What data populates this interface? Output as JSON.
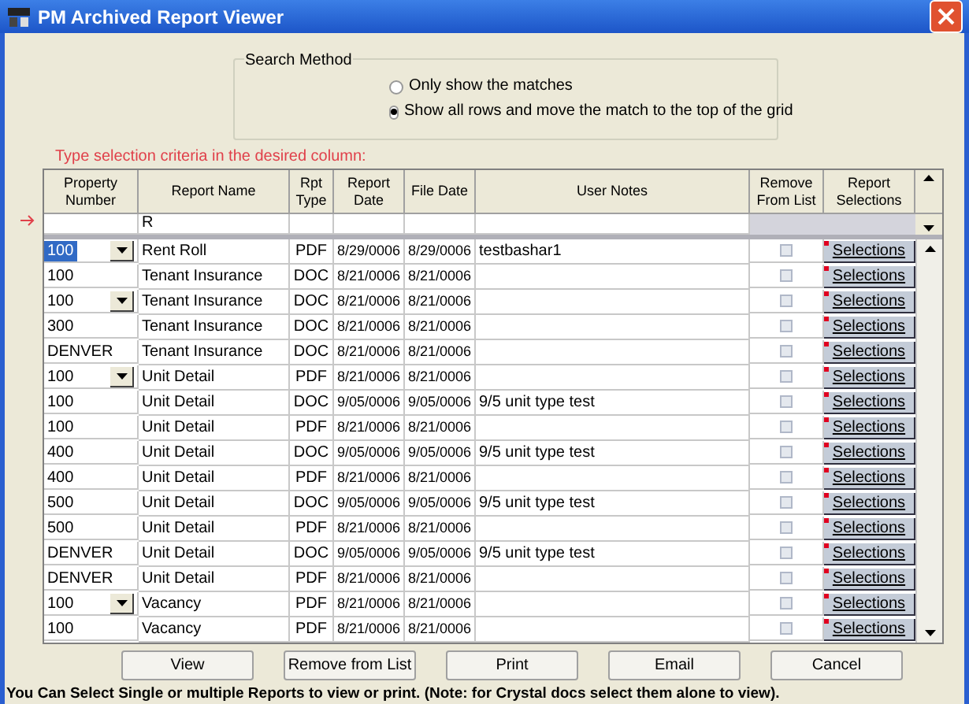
{
  "window": {
    "title": "PM Archived Report Viewer"
  },
  "search_method": {
    "legend": "Search Method",
    "options": [
      {
        "label": "Only show the matches",
        "selected": false
      },
      {
        "label": "Show all rows and move the match to the top of the grid",
        "selected": true
      }
    ]
  },
  "criteria_hint": "Type selection criteria in the desired column:",
  "table": {
    "columns": [
      "Property Number",
      "Report Name",
      "Rpt Type",
      "Report Date",
      "File Date",
      "User Notes",
      "Remove From List",
      "Report Selections"
    ],
    "filter": {
      "report_name": "R"
    },
    "rows": [
      {
        "property": "100",
        "name": "Rent Roll",
        "type": "PDF",
        "report_date": "8/29/0006",
        "file_date": "8/29/0006",
        "notes": "testbashar1",
        "dropdown": true,
        "selected": true,
        "checked": false,
        "action": "Selections"
      },
      {
        "property": "100",
        "name": "Tenant Insurance",
        "type": "DOC",
        "report_date": "8/21/0006",
        "file_date": "8/21/0006",
        "notes": "",
        "dropdown": false,
        "selected": false,
        "checked": false,
        "action": "Selections"
      },
      {
        "property": "100",
        "name": "Tenant Insurance",
        "type": "DOC",
        "report_date": "8/21/0006",
        "file_date": "8/21/0006",
        "notes": "",
        "dropdown": true,
        "selected": false,
        "checked": false,
        "action": "Selections"
      },
      {
        "property": "300",
        "name": "Tenant Insurance",
        "type": "DOC",
        "report_date": "8/21/0006",
        "file_date": "8/21/0006",
        "notes": "",
        "dropdown": false,
        "selected": false,
        "checked": false,
        "action": "Selections"
      },
      {
        "property": "DENVER",
        "name": "Tenant Insurance",
        "type": "DOC",
        "report_date": "8/21/0006",
        "file_date": "8/21/0006",
        "notes": "",
        "dropdown": false,
        "selected": false,
        "checked": false,
        "action": "Selections"
      },
      {
        "property": "100",
        "name": "Unit Detail",
        "type": "PDF",
        "report_date": "8/21/0006",
        "file_date": "8/21/0006",
        "notes": "",
        "dropdown": true,
        "selected": false,
        "checked": false,
        "action": "Selections"
      },
      {
        "property": "100",
        "name": "Unit Detail",
        "type": "DOC",
        "report_date": "9/05/0006",
        "file_date": "9/05/0006",
        "notes": "9/5 unit type test",
        "dropdown": false,
        "selected": false,
        "checked": false,
        "action": "Selections"
      },
      {
        "property": "100",
        "name": "Unit Detail",
        "type": "PDF",
        "report_date": "8/21/0006",
        "file_date": "8/21/0006",
        "notes": "",
        "dropdown": false,
        "selected": false,
        "checked": false,
        "action": "Selections"
      },
      {
        "property": "400",
        "name": "Unit Detail",
        "type": "DOC",
        "report_date": "9/05/0006",
        "file_date": "9/05/0006",
        "notes": "9/5 unit type test",
        "dropdown": false,
        "selected": false,
        "checked": false,
        "action": "Selections"
      },
      {
        "property": "400",
        "name": "Unit Detail",
        "type": "PDF",
        "report_date": "8/21/0006",
        "file_date": "8/21/0006",
        "notes": "",
        "dropdown": false,
        "selected": false,
        "checked": false,
        "action": "Selections"
      },
      {
        "property": "500",
        "name": "Unit Detail",
        "type": "DOC",
        "report_date": "9/05/0006",
        "file_date": "9/05/0006",
        "notes": "9/5 unit type test",
        "dropdown": false,
        "selected": false,
        "checked": false,
        "action": "Selections"
      },
      {
        "property": "500",
        "name": "Unit Detail",
        "type": "PDF",
        "report_date": "8/21/0006",
        "file_date": "8/21/0006",
        "notes": "",
        "dropdown": false,
        "selected": false,
        "checked": false,
        "action": "Selections"
      },
      {
        "property": "DENVER",
        "name": "Unit Detail",
        "type": "DOC",
        "report_date": "9/05/0006",
        "file_date": "9/05/0006",
        "notes": "9/5 unit type test",
        "dropdown": false,
        "selected": false,
        "checked": false,
        "action": "Selections"
      },
      {
        "property": "DENVER",
        "name": "Unit Detail",
        "type": "PDF",
        "report_date": "8/21/0006",
        "file_date": "8/21/0006",
        "notes": "",
        "dropdown": false,
        "selected": false,
        "checked": false,
        "action": "Selections"
      },
      {
        "property": "100",
        "name": "Vacancy",
        "type": "PDF",
        "report_date": "8/21/0006",
        "file_date": "8/21/0006",
        "notes": "",
        "dropdown": true,
        "selected": false,
        "checked": false,
        "action": "Selections"
      },
      {
        "property": "100",
        "name": "Vacancy",
        "type": "PDF",
        "report_date": "8/21/0006",
        "file_date": "8/21/0006",
        "notes": "",
        "dropdown": false,
        "selected": false,
        "checked": false,
        "action": "Selections"
      }
    ]
  },
  "buttons": [
    {
      "label": "View"
    },
    {
      "label": "Remove from List"
    },
    {
      "label": "Print"
    },
    {
      "label": "Email"
    },
    {
      "label": "Cancel"
    }
  ],
  "status_bar": "You Can Select Single or multiple Reports to view or print. (Note: for Crystal docs select them alone to view)."
}
